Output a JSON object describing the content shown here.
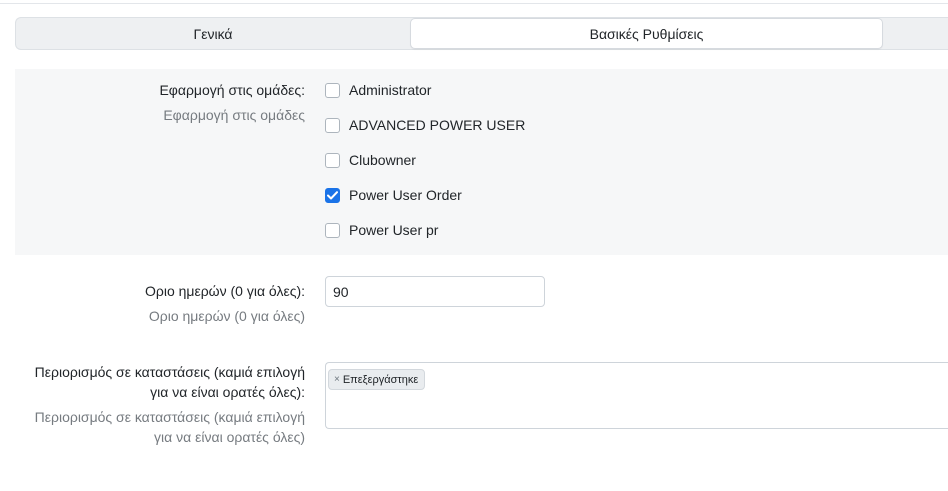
{
  "tabs": [
    {
      "label": "Γενικά"
    },
    {
      "label": "Βασικές Ρυθμίσεις",
      "active": true
    }
  ],
  "groups_field": {
    "label": "Εφαρμογή στις ομάδες:",
    "help": "Εφαρμογή στις ομάδες",
    "options": [
      {
        "label": "Administrator",
        "checked": false
      },
      {
        "label": "ADVANCED POWER USER",
        "checked": false
      },
      {
        "label": "Clubowner",
        "checked": false
      },
      {
        "label": "Power User Order",
        "checked": true
      },
      {
        "label": "Power User pr",
        "checked": false
      }
    ]
  },
  "days_field": {
    "label": "Οριο ημερών (0 για όλες):",
    "help": "Οριο ημερών (0 για όλες)",
    "value": "90"
  },
  "status_field": {
    "label_line1": "Περιορισμός σε καταστάσεις (καμιά επιλογή",
    "label_line2": "για να είναι ορατές όλες):",
    "help_line1": "Περιορισμός σε καταστάσεις (καμιά επιλογή",
    "help_line2": "για να είναι ορατές όλες)",
    "selected": [
      {
        "remove": "×",
        "label": "Επεξεργάστηκε"
      }
    ]
  },
  "colors": {
    "accent": "#1a73e8",
    "row_bg": "#f6f7f8",
    "muted_text": "#767b80"
  }
}
